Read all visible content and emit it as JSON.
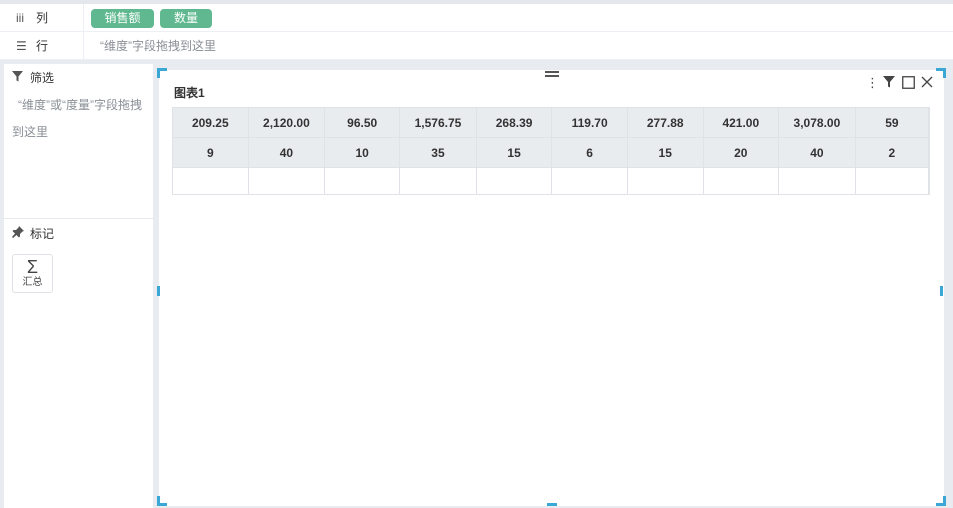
{
  "shelves": {
    "columns": {
      "icon": "columns-icon",
      "label": "列",
      "pills": [
        "销售额",
        "数量"
      ]
    },
    "rows": {
      "icon": "list-icon",
      "label": "行",
      "placeholder": "“维度”字段拖拽到这里"
    }
  },
  "filter": {
    "icon": "funnel-icon",
    "title": "筛选",
    "hint": "“维度”或“度量”字段拖拽到这里"
  },
  "marks": {
    "icon": "pin-icon",
    "title": "标记",
    "sum_label": "汇总"
  },
  "chart": {
    "title": "图表1",
    "tools": [
      "more-icon",
      "funnel-icon",
      "maximize-icon",
      "close-icon"
    ],
    "rows": [
      [
        "209.25",
        "2,120.00",
        "96.50",
        "1,576.75",
        "268.39",
        "119.70",
        "277.88",
        "421.00",
        "3,078.00",
        "59"
      ],
      [
        "9",
        "40",
        "10",
        "35",
        "15",
        "6",
        "15",
        "20",
        "40",
        "2"
      ]
    ],
    "accent": "#3ba7d4",
    "pill_color": "#5fb88f"
  }
}
